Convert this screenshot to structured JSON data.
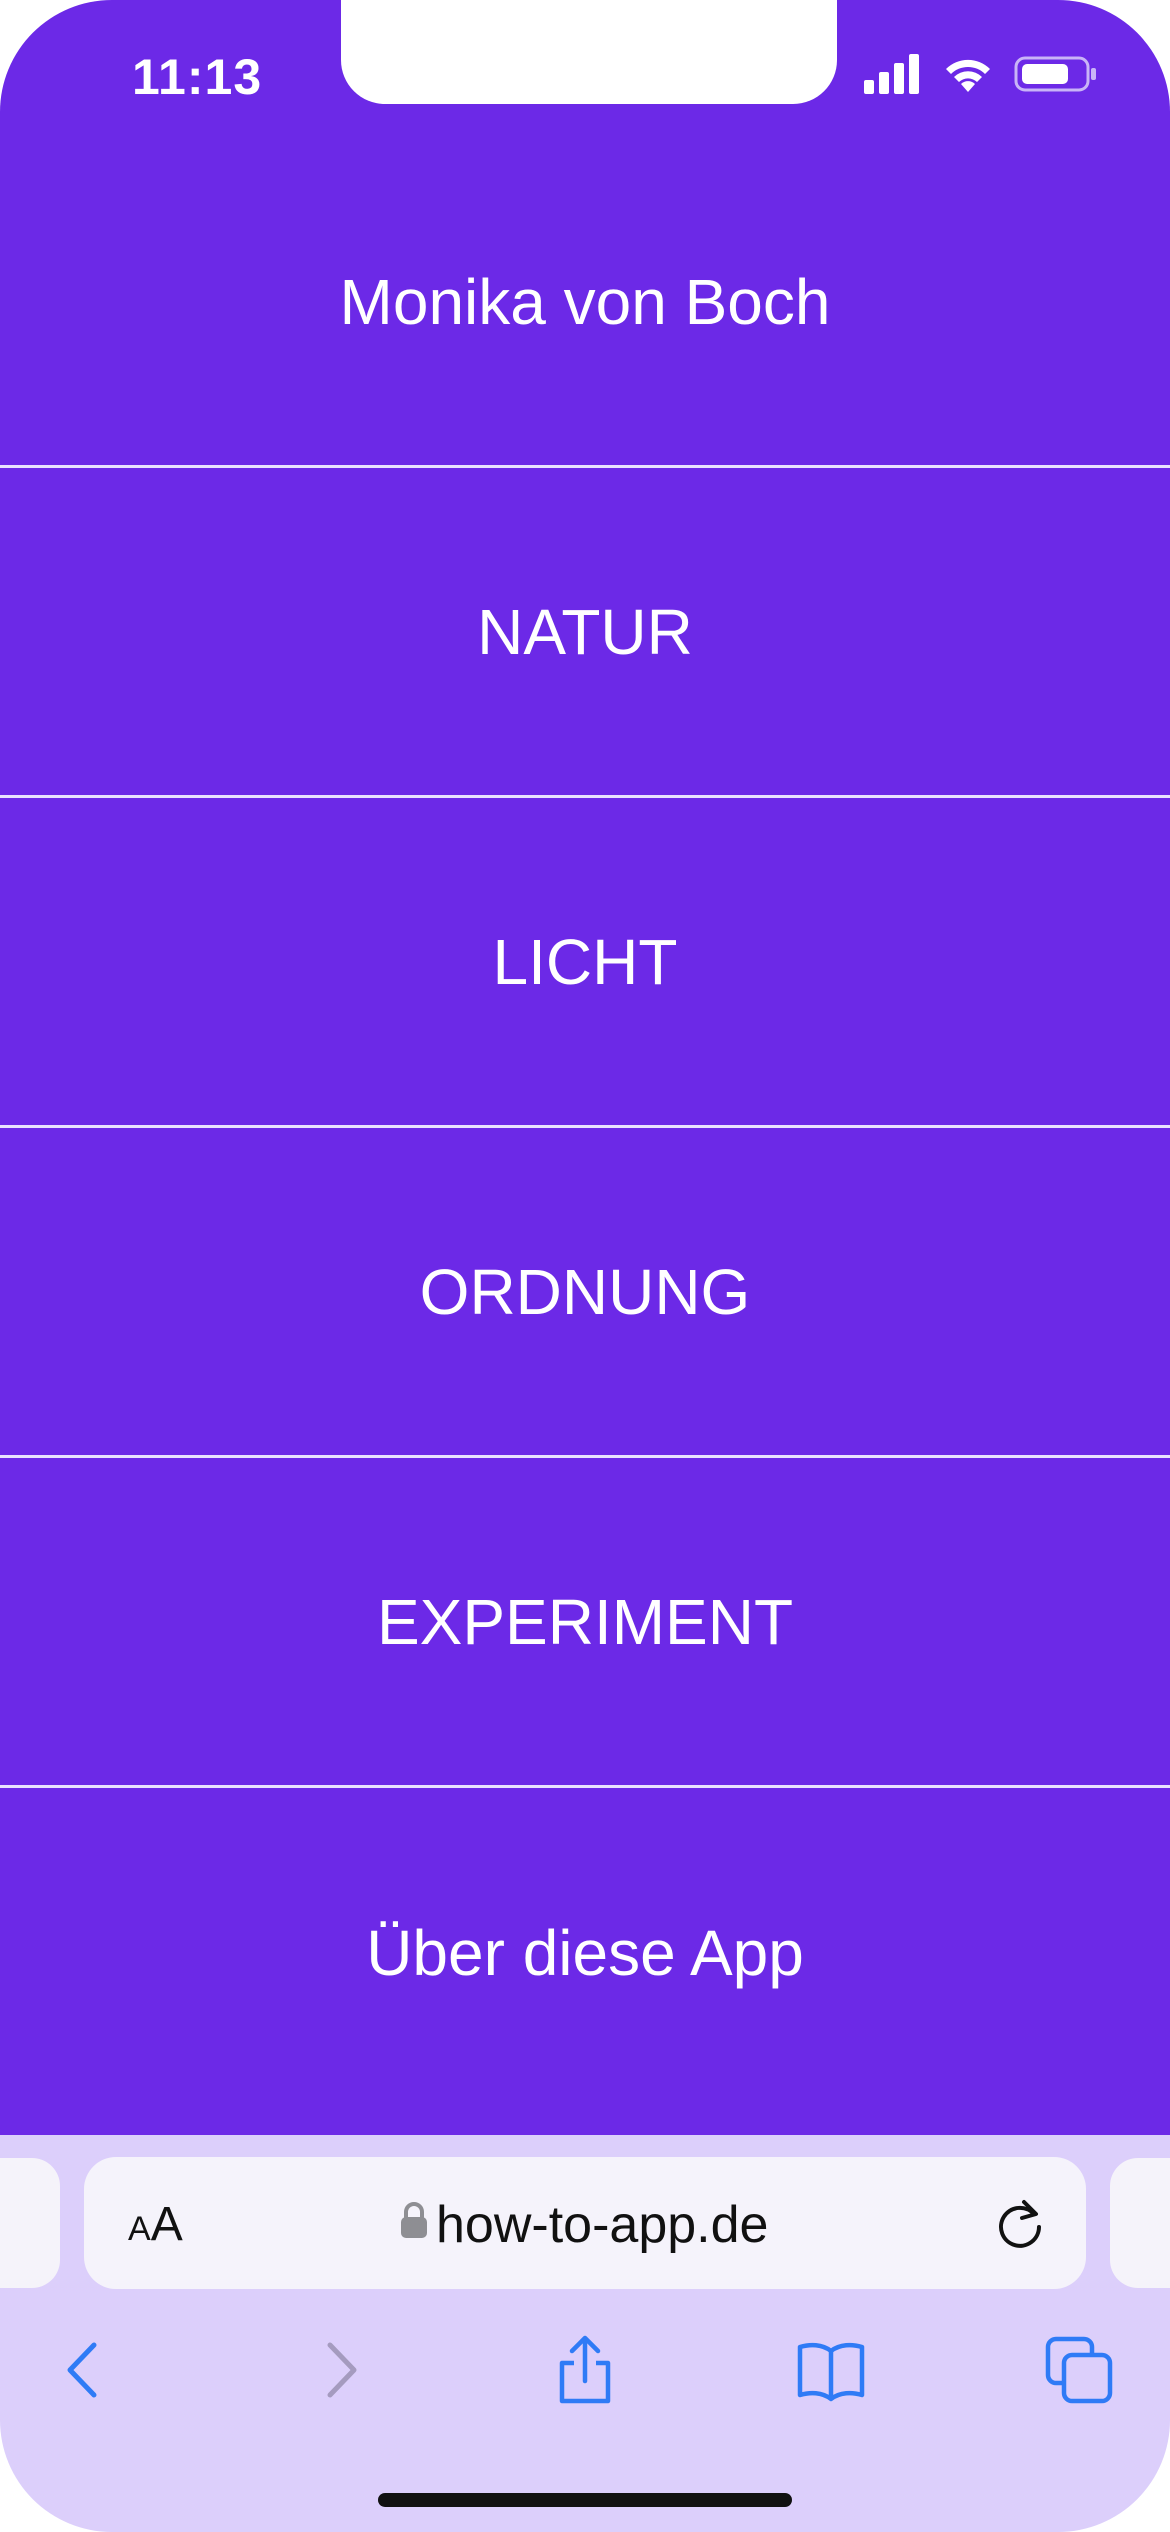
{
  "status_bar": {
    "time": "11:13"
  },
  "menu": {
    "items": [
      {
        "label": "Monika von Boch"
      },
      {
        "label": "NATUR"
      },
      {
        "label": "LICHT"
      },
      {
        "label": "ORDNUNG"
      },
      {
        "label": "EXPERIMENT"
      },
      {
        "label": "Über diese App"
      }
    ]
  },
  "browser": {
    "text_size_label_small": "A",
    "text_size_label_large": "A",
    "url": "how-to-app.de",
    "toolbar_icons": [
      "back-icon",
      "forward-icon",
      "share-icon",
      "bookmarks-icon",
      "tabs-icon"
    ]
  },
  "colors": {
    "accent": "#6c29e7",
    "browser_chrome": "#dccffb",
    "url_bar": "#f5f3fb",
    "system_blue": "#2f7bf6"
  }
}
